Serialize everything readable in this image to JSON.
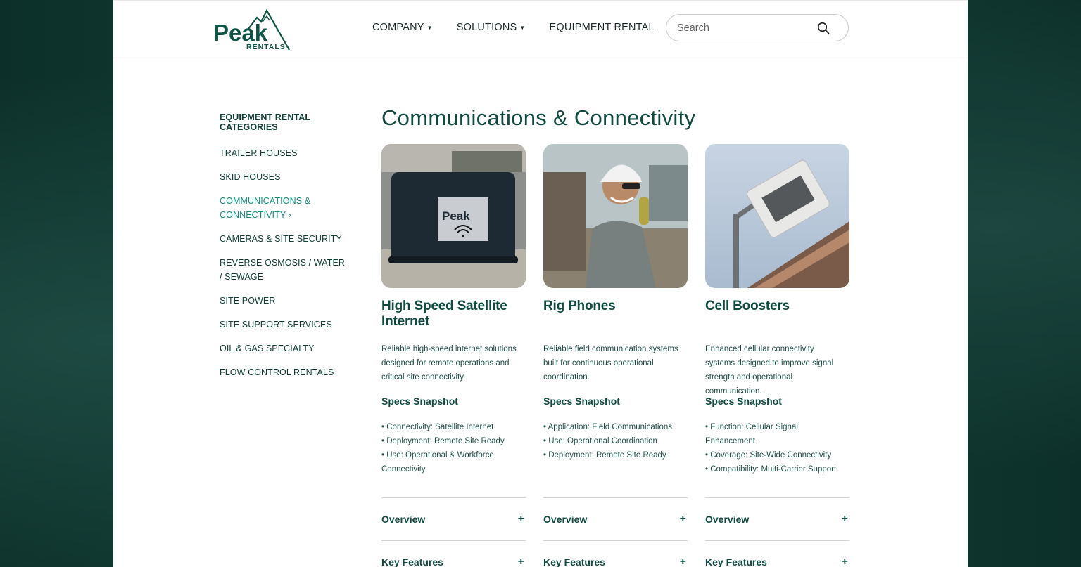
{
  "brand": {
    "name": "Peak",
    "sub": "RENTALS",
    "color": "#0f5446"
  },
  "nav": {
    "items": [
      {
        "label": "COMPANY",
        "dropdown": true
      },
      {
        "label": "SOLUTIONS",
        "dropdown": true
      },
      {
        "label": "EQUIPMENT RENTAL",
        "dropdown": false
      }
    ],
    "search_placeholder": "Search"
  },
  "sidebar": {
    "heading": "EQUIPMENT RENTAL CATEGORIES",
    "items": [
      {
        "label": "TRAILER HOUSES"
      },
      {
        "label": "SKID HOUSES"
      },
      {
        "label": "COMMUNICATIONS & CONNECTIVITY ›",
        "active": true
      },
      {
        "label": "CAMERAS & SITE SECURITY"
      },
      {
        "label": "REVERSE OSMOSIS / WATER / SEWAGE"
      },
      {
        "label": "SITE POWER"
      },
      {
        "label": "SITE SUPPORT SERVICES"
      },
      {
        "label": "OIL & GAS SPECIALTY"
      },
      {
        "label": "FLOW CONTROL RENTALS"
      }
    ]
  },
  "main": {
    "title": "Communications & Connectivity",
    "cards": [
      {
        "title": "High Speed Satellite Internet",
        "description": "Reliable high-speed internet solutions designed for remote operations and critical site connectivity.",
        "specs_heading": "Specs Snapshot",
        "specs": [
          "• Connectivity: Satellite Internet",
          "• Deployment: Remote Site Ready",
          "• Use: Operational & Workforce Connectivity"
        ],
        "accordion": [
          "Overview",
          "Key Features"
        ],
        "image": "satellite-case-photo"
      },
      {
        "title": "Rig Phones",
        "description": "Reliable field communication systems built for continuous operational coordination.",
        "specs_heading": "Specs Snapshot",
        "specs": [
          "• Application: Field Communications",
          "• Use: Operational Coordination",
          "• Deployment: Remote Site Ready"
        ],
        "accordion": [
          "Overview",
          "Key Features"
        ],
        "image": "worker-on-phone-photo"
      },
      {
        "title": "Cell Boosters",
        "description": "Enhanced cellular connectivity systems designed to improve signal strength and operational communication.",
        "specs_heading": "Specs Snapshot",
        "specs": [
          "• Function: Cellular Signal Enhancement",
          "• Coverage: Site-Wide Connectivity",
          "• Compatibility: Multi-Carrier Support"
        ],
        "accordion": [
          "Overview",
          "Key Features"
        ],
        "image": "cell-booster-antenna-photo"
      }
    ]
  },
  "accordion_icon": "+"
}
